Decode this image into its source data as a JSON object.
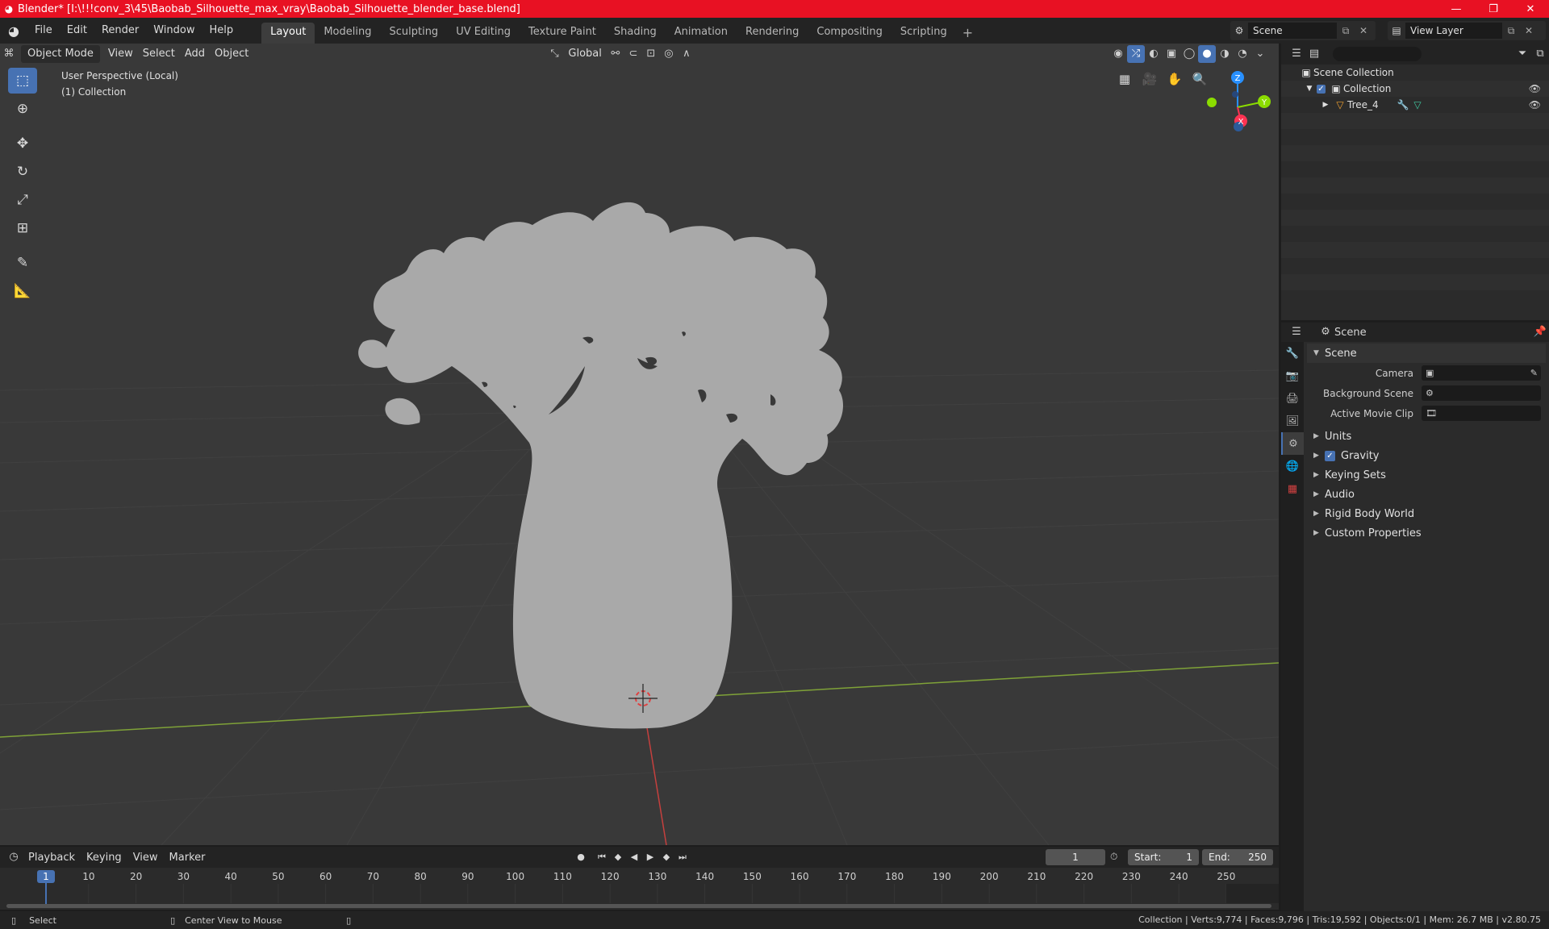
{
  "window": {
    "title": "Blender* [I:\\!!!conv_3\\45\\Baobab_Silhouette_max_vray\\Baobab_Silhouette_blender_base.blend]",
    "minimize_icon": "minimize-icon",
    "maximize_icon": "restore-icon",
    "close_icon": "close-icon"
  },
  "menu": {
    "items": [
      "File",
      "Edit",
      "Render",
      "Window",
      "Help"
    ]
  },
  "workspaces": {
    "tabs": [
      "Layout",
      "Modeling",
      "Sculpting",
      "UV Editing",
      "Texture Paint",
      "Shading",
      "Animation",
      "Rendering",
      "Compositing",
      "Scripting"
    ],
    "active": "Layout",
    "add_label": "+"
  },
  "scene_selector": {
    "value": "Scene"
  },
  "view_layer_selector": {
    "value": "View Layer"
  },
  "viewport": {
    "mode": "Object Mode",
    "menus": [
      "View",
      "Select",
      "Add",
      "Object"
    ],
    "transform_orientation": "Global",
    "info_line1": "User Perspective (Local)",
    "info_line2": "(1) Collection",
    "gizmo": {
      "x": "X",
      "y": "Y",
      "z": "Z"
    },
    "colors": {
      "x_axis": "#ff3352",
      "y_axis": "#8bdc00",
      "z_axis": "#2890ff",
      "accent": "#4772b3"
    }
  },
  "outliner": {
    "search_placeholder": "",
    "rows": [
      {
        "label": "Scene Collection"
      },
      {
        "label": "Collection"
      },
      {
        "label": "Tree_4"
      }
    ]
  },
  "properties": {
    "context_label": "Scene",
    "section_open": "Scene",
    "fields": [
      {
        "label": "Camera"
      },
      {
        "label": "Background Scene"
      },
      {
        "label": "Active Movie Clip"
      }
    ],
    "sections": [
      {
        "label": "Units",
        "checkbox": false
      },
      {
        "label": "Gravity",
        "checkbox": true
      },
      {
        "label": "Keying Sets",
        "checkbox": false
      },
      {
        "label": "Audio",
        "checkbox": false
      },
      {
        "label": "Rigid Body World",
        "checkbox": false
      },
      {
        "label": "Custom Properties",
        "checkbox": false
      }
    ]
  },
  "timeline": {
    "menus": [
      "Playback",
      "Keying",
      "View",
      "Marker"
    ],
    "current_frame": "1",
    "start_label": "Start:",
    "start_value": "1",
    "end_label": "End:",
    "end_value": "250",
    "ruler_marks": [
      "1",
      "10",
      "20",
      "30",
      "40",
      "50",
      "60",
      "70",
      "80",
      "90",
      "100",
      "110",
      "120",
      "130",
      "140",
      "150",
      "160",
      "170",
      "180",
      "190",
      "200",
      "210",
      "220",
      "230",
      "240",
      "250"
    ]
  },
  "statusbar": {
    "left_action": "Select",
    "middle_action": "Center View to Mouse",
    "stats": "Collection | Verts:9,774 | Faces:9,796 | Tris:19,592 | Objects:0/1 | Mem: 26.7 MB | v2.80.75"
  }
}
